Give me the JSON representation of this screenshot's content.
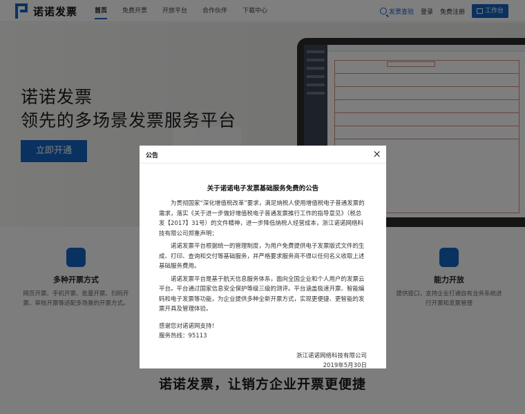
{
  "header": {
    "logo_text": "诺诺发票",
    "nav": [
      "首页",
      "免费开票",
      "开放平台",
      "合作伙伴",
      "下载中心"
    ],
    "verify_label": "发票查验",
    "login_label": "登录",
    "register_label": "免费注册",
    "workbench_label": "工作台",
    "accent_color": "#1565c0"
  },
  "hero": {
    "title_line1": "诺诺发票",
    "title_line2": "领先的多场景发票服务平台",
    "cta_label": "立即开通"
  },
  "features": [
    {
      "icon": "cubes-icon",
      "title": "多种开票方式",
      "desc": "网页开票、手机开票、批量开票、扫码开票、审核开票等适配多场景的开票方式。"
    },
    {
      "icon": "api-icon",
      "title": "能力开放",
      "desc": "提供接口，支持企业打通自有业务系统进行开票和发票管理"
    }
  ],
  "slogan": "诺诺发票，让销方企业开票更便捷",
  "modal": {
    "title": "公告",
    "close_label": "×",
    "notice_title": "关于诺诺电子发票基础服务免费的公告",
    "paragraphs": [
      "为贯彻国家“深化增值税改革”要求，满足纳税人使用增值税电子普通发票的需求，落实《关于进一步做好增值税电子普通发票推行工作的指导意见》（税总发【2017】31号）的文件精神，进一步降低纳税人经营成本，浙江诺诺网络科技有限公司郑重声明：",
      "诺诺发票平台根据统一的管理制度，为用户免费提供电子发票版式文件的生成、打印、查询和交付等基础服务，并严格要求服务商不得以任何名义收取上述基础服务费用。",
      "诺诺发票平台是基于航天信息服务体系，面向全国企业和个人用户的发票云平台。平台通过国家信息安全保护等级三级的测评。平台涵盖极速开票、智能编码和电子发票等功能，为企业提供多种全新开票方式，实现更便捷、更智能的发票开具及管理体验。"
    ],
    "thanks": "感谢您对诺诺网支持！",
    "hotline": "服务热线：95113",
    "signer": "浙江诺诺网络科技有限公司",
    "date": "2019年5月30日"
  }
}
